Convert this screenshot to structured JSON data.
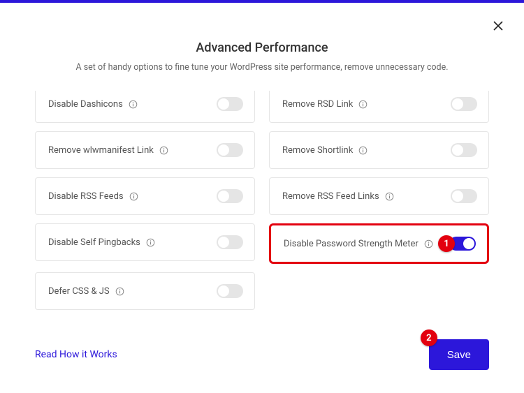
{
  "header": {
    "title": "Advanced Performance",
    "subtitle": "A set of handy options to fine tune your WordPress site performance, remove unnecessary code."
  },
  "options": {
    "disable_dashicons": {
      "label": "Disable Dashicons",
      "on": false
    },
    "remove_rsd": {
      "label": "Remove RSD Link",
      "on": false
    },
    "remove_wlw": {
      "label": "Remove wlwmanifest Link",
      "on": false
    },
    "remove_shortlink": {
      "label": "Remove Shortlink",
      "on": false
    },
    "disable_rss": {
      "label": "Disable RSS Feeds",
      "on": false
    },
    "remove_rss_links": {
      "label": "Remove RSS Feed Links",
      "on": false
    },
    "disable_pingbacks": {
      "label": "Disable Self Pingbacks",
      "on": false
    },
    "disable_pwd_meter": {
      "label": "Disable Password Strength Meter",
      "on": true
    },
    "defer_css_js": {
      "label": "Defer CSS & JS",
      "on": false
    }
  },
  "markers": {
    "m1": "1",
    "m2": "2"
  },
  "footer": {
    "help_link": "Read How it Works",
    "save": "Save"
  }
}
